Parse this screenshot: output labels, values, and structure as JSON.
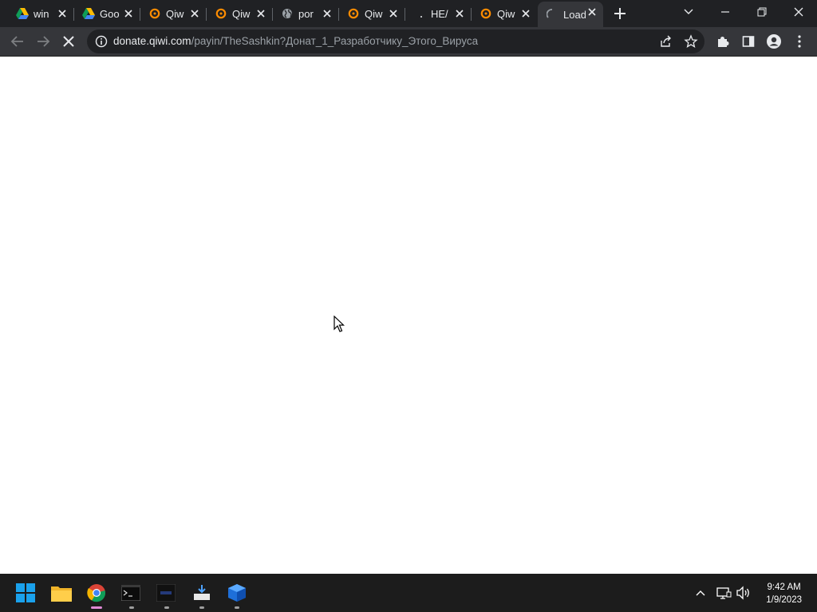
{
  "browser": {
    "tabs": [
      {
        "label": "win",
        "icon": "google-drive-icon"
      },
      {
        "label": "Goo",
        "icon": "google-drive-icon"
      },
      {
        "label": "Qiw",
        "icon": "qiwi-icon"
      },
      {
        "label": "Qiw",
        "icon": "qiwi-icon"
      },
      {
        "label": "por",
        "icon": "globe-icon"
      },
      {
        "label": "Qiw",
        "icon": "qiwi-icon"
      },
      {
        "label": "НЕ/",
        "icon": "blank-favicon"
      },
      {
        "label": "Qiw",
        "icon": "qiwi-icon"
      },
      {
        "label": "Load",
        "icon": "loading-spinner-icon"
      }
    ],
    "active_tab_index": 8,
    "address": {
      "host": "donate.qiwi.com",
      "path": "/payin/TheSashkin?Донат_1_Разработчику_Этого_Вируса"
    },
    "colors": {
      "tab_strip": "#202124",
      "toolbar": "#35363a",
      "qiwi_orange": "#ff8c00"
    }
  },
  "taskbar": {
    "apps": [
      "start-icon",
      "file-explorer-icon",
      "chrome-icon",
      "terminal-icon",
      "app-icon",
      "download-installer-icon",
      "blue-cube-app-icon"
    ],
    "clock": {
      "time": "9:42 AM",
      "date": "1/9/2023"
    }
  }
}
